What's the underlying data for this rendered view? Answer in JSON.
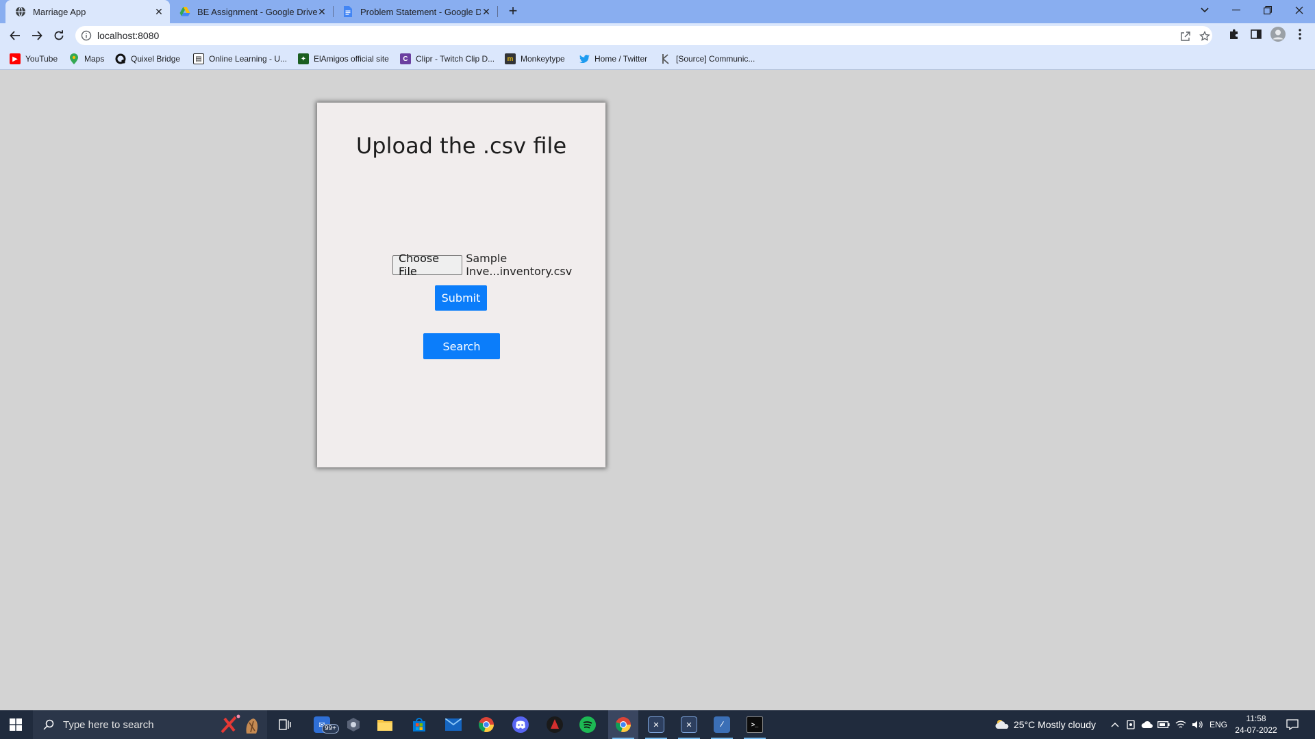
{
  "browser": {
    "tabs": [
      {
        "title": "Marriage App",
        "active": true,
        "icon": "globe-icon"
      },
      {
        "title": "BE Assignment - Google Drive",
        "active": false,
        "icon": "google-drive-icon"
      },
      {
        "title": "Problem Statement - Google Doc",
        "active": false,
        "icon": "google-docs-icon"
      }
    ],
    "close_glyph": "✕",
    "new_tab_glyph": "+",
    "url": "localhost:8080"
  },
  "bookmarks": [
    {
      "label": "YouTube",
      "icon": "youtube-icon",
      "color": "#ff0000"
    },
    {
      "label": "Maps",
      "icon": "maps-icon",
      "color": "#34a853"
    },
    {
      "label": "Quixel Bridge",
      "icon": "quixel-icon",
      "color": "#111111"
    },
    {
      "label": "Online Learning - U...",
      "icon": "book-icon",
      "color": "#333333"
    },
    {
      "label": "ElAmigos official site",
      "icon": "elamigos-icon",
      "color": "#2e7d32"
    },
    {
      "label": "Clipr - Twitch Clip D...",
      "icon": "clipr-icon",
      "color": "#6b3fa0"
    },
    {
      "label": "Monkeytype",
      "icon": "monkeytype-icon",
      "color": "#323437"
    },
    {
      "label": "Home / Twitter",
      "icon": "twitter-icon",
      "color": "#1d9bf0"
    },
    {
      "label": "[Source] Communic...",
      "icon": "source-icon",
      "color": "#555555"
    }
  ],
  "page": {
    "title": "Upload the .csv file",
    "choose_file_label": "Choose File",
    "file_name": "Sample Inve...inventory.csv",
    "submit_label": "Submit",
    "search_label": "Search"
  },
  "taskbar": {
    "search_placeholder": "Type here to search",
    "mail_badge": "99+",
    "weather": "25°C  Mostly cloudy",
    "language": "ENG",
    "time": "11:58",
    "date": "24-07-2022"
  },
  "colors": {
    "accent": "#0b7dfa",
    "tab_strip": "#89aef0",
    "toolbar": "#dbe7fc",
    "page_bg": "#d3d3d3",
    "card_bg": "#f1eded",
    "taskbar": "#202b3d"
  }
}
